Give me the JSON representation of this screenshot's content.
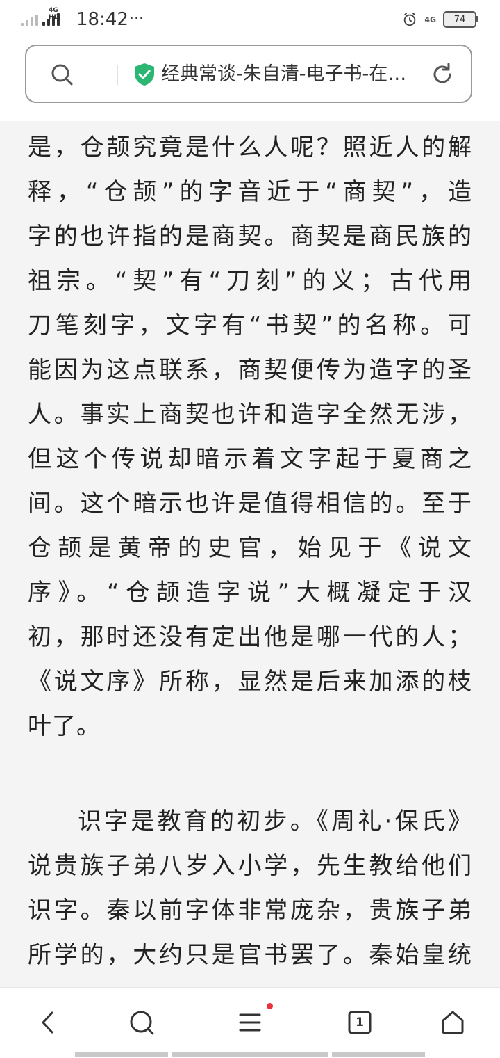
{
  "status_bar": {
    "network_left": "4G HD",
    "time": "18:42",
    "more": "···",
    "network_right": "4G",
    "battery": "74"
  },
  "address_bar": {
    "title": "经典常谈-朱自清-电子书-在…"
  },
  "article": {
    "para1_lines": [
      "是，仓颉究竟是什么人呢？照近人的解",
      "释，“仓颉”的字音近于“商契”，造",
      "字的也许指的是商契。商契是商民族的",
      "祖宗。“契”有“刀刻”的义；古代用",
      "刀笔刻字，文字有“书契”的名称。可",
      "能因为这点联系，商契便传为造字的圣",
      "人。事实上商契也许和造字全然无涉，",
      "但这个传说却暗示着文字起于夏商之",
      "间。这个暗示也许是值得相信的。至于",
      "仓颉是黄帝的史官，始见于《说文",
      "序》。“仓颉造字说”大概凝定于汉",
      "初，那时还没有定出他是哪一代的人；",
      "《说文序》所称，显然是后来加添的枝",
      "叶了。"
    ],
    "para2_lines": [
      "识字是教育的初步。《周礼·保氏》",
      "说贵族子弟八岁入小学，先生教给他们",
      "识字。秦以前字体非常庞杂，贵族子弟",
      "所学的，大约只是官书罢了。秦始皇统"
    ]
  },
  "bottom_nav": {
    "tab_count": "1"
  },
  "colors": {
    "shield_green": "#2bb673",
    "notification_dot": "#e8323c"
  }
}
